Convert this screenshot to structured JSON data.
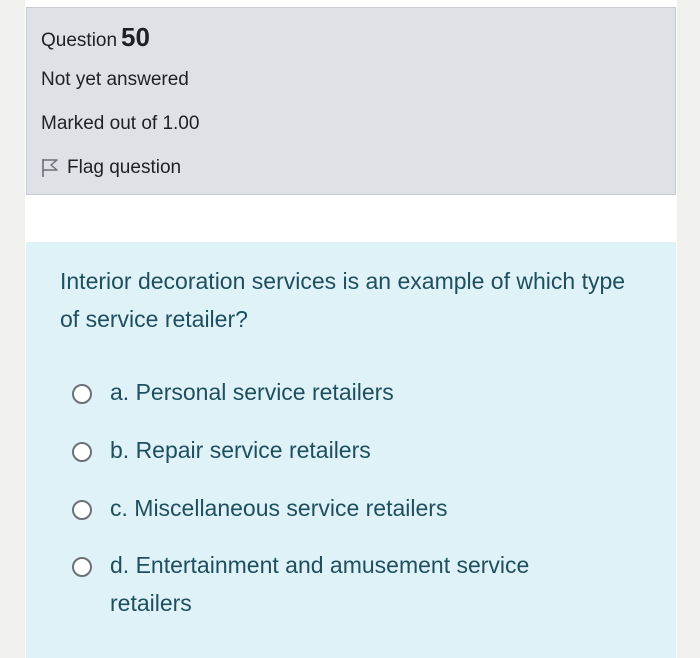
{
  "question": {
    "label": "Question",
    "number": "50",
    "state": "Not yet answered",
    "grade": "Marked out of 1.00",
    "flag_label": "Flag question",
    "text": "Interior decoration services is an example of which type of service retailer?",
    "options": [
      {
        "label": "a. Personal service retailers"
      },
      {
        "label": "b. Repair service retailers"
      },
      {
        "label": "c. Miscellaneous service retailers"
      },
      {
        "label": "d. Entertainment and amusement service retailers"
      }
    ]
  },
  "colors": {
    "info_background": "#dee2e6",
    "content_background": "#def2f8",
    "question_text": "#1f4f5e"
  }
}
